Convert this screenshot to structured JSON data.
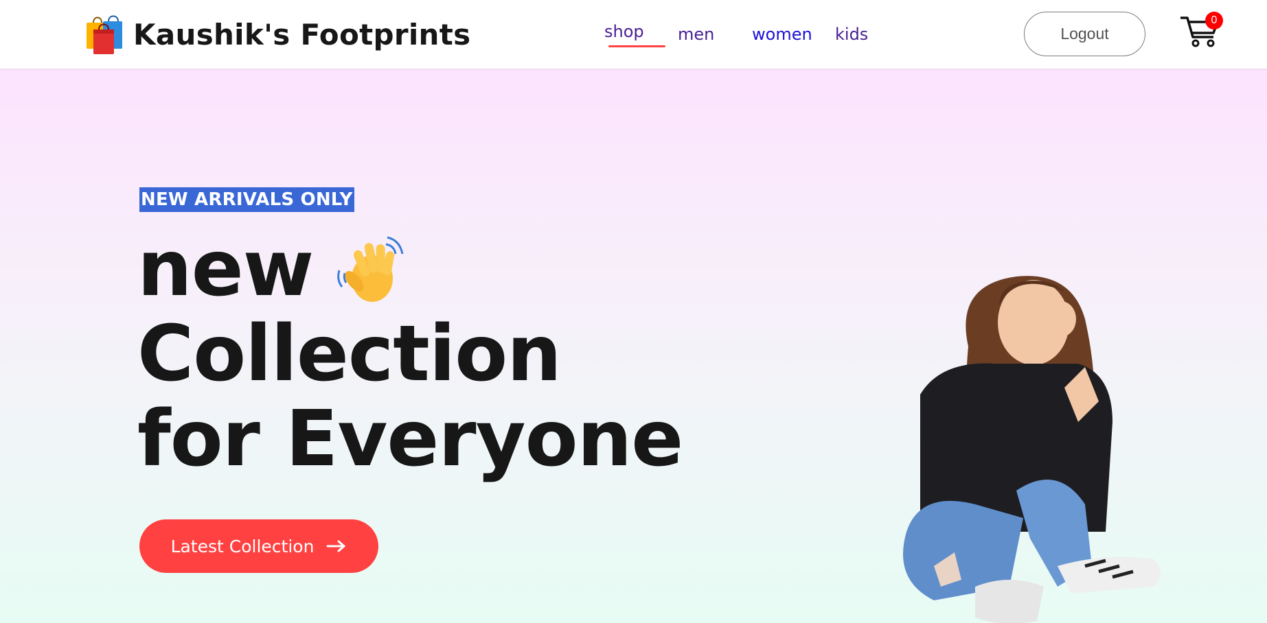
{
  "navbar": {
    "brand": "Kaushik's Footprints",
    "logo_icon": "shopping-bags-icon",
    "menu": [
      {
        "label": "shop",
        "active": true
      },
      {
        "label": "men",
        "active": false
      },
      {
        "label": "women",
        "active": false
      },
      {
        "label": "kids",
        "active": false
      }
    ],
    "logout_label": "Logout",
    "cart_icon": "cart-icon",
    "cart_count": "0"
  },
  "hero": {
    "tagline": "NEW ARRIVALS ONLY",
    "headline": [
      "new",
      "Collection",
      "for Everyone"
    ],
    "wave_icon": "waving-hand-icon",
    "cta_label": "Latest Collection",
    "cta_icon": "arrow-right-icon",
    "image": "hero-model-image"
  },
  "colors": {
    "accent": "#ff4141",
    "nav_text": "#4a2094",
    "nav_women": "#1a10d8",
    "tagline_bg": "#3a67d6",
    "heading": "#171717",
    "cart_badge": "#ff0000"
  }
}
